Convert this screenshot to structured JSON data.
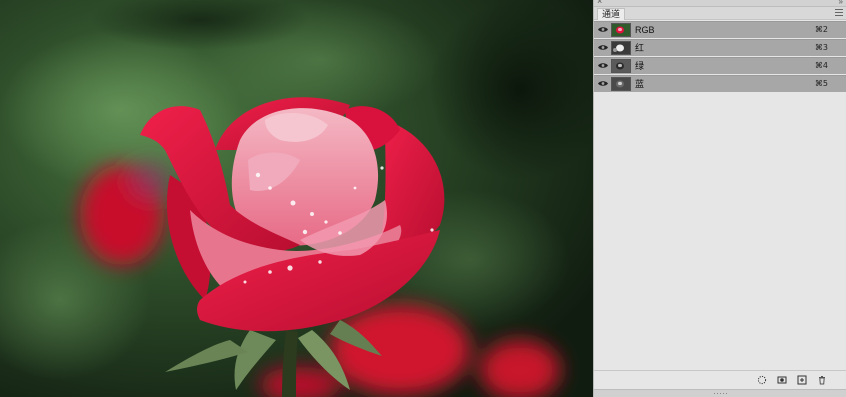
{
  "panel": {
    "tab_label": "通道",
    "menu_icon": "panel-menu-icon",
    "channels": [
      {
        "name": "RGB",
        "shortcut": "⌘2",
        "thumb": "color"
      },
      {
        "name": "红",
        "shortcut": "⌘3",
        "thumb": "gray-light"
      },
      {
        "name": "绿",
        "shortcut": "⌘4",
        "thumb": "gray-dark"
      },
      {
        "name": "蓝",
        "shortcut": "⌘5",
        "thumb": "gray-mid"
      }
    ],
    "bottom_icons": [
      "load-selection-icon",
      "save-selection-icon",
      "new-channel-icon",
      "delete-channel-icon"
    ]
  },
  "colors": {
    "panel_bg": "#e6e6e6",
    "row_bg": "#a7a7a7",
    "rose": "#e0143c"
  }
}
